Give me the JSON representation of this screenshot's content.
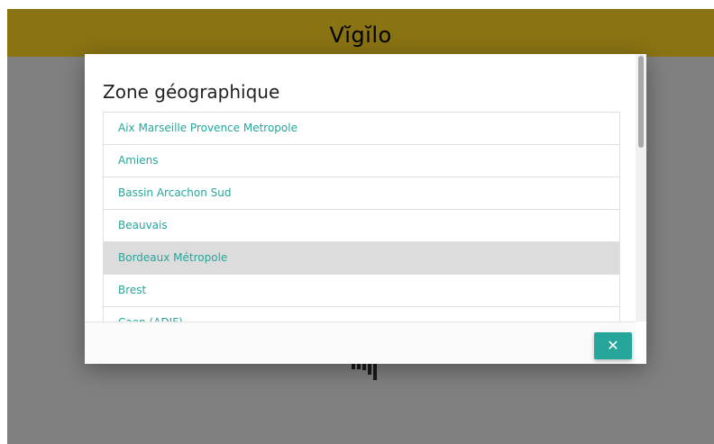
{
  "header": {
    "app_title": "Vĭgĭlo"
  },
  "modal": {
    "title": "Zone géographique",
    "zones": [
      {
        "label": "Aix Marseille Provence Metropole",
        "selected": false
      },
      {
        "label": "Amiens",
        "selected": false
      },
      {
        "label": "Bassin Arcachon Sud",
        "selected": false
      },
      {
        "label": "Beauvais",
        "selected": false
      },
      {
        "label": "Bordeaux Métropole",
        "selected": true
      },
      {
        "label": "Brest",
        "selected": false
      },
      {
        "label": "Caen (ADIF)",
        "selected": false
      }
    ],
    "close_label": "✕"
  },
  "colors": {
    "header_bg": "#8a7313",
    "accent": "#26a69a",
    "backdrop": "#808080",
    "selected_row": "#dcdcdc"
  },
  "icons": {
    "close": "close-icon",
    "loader": "loading-bars-icon"
  }
}
